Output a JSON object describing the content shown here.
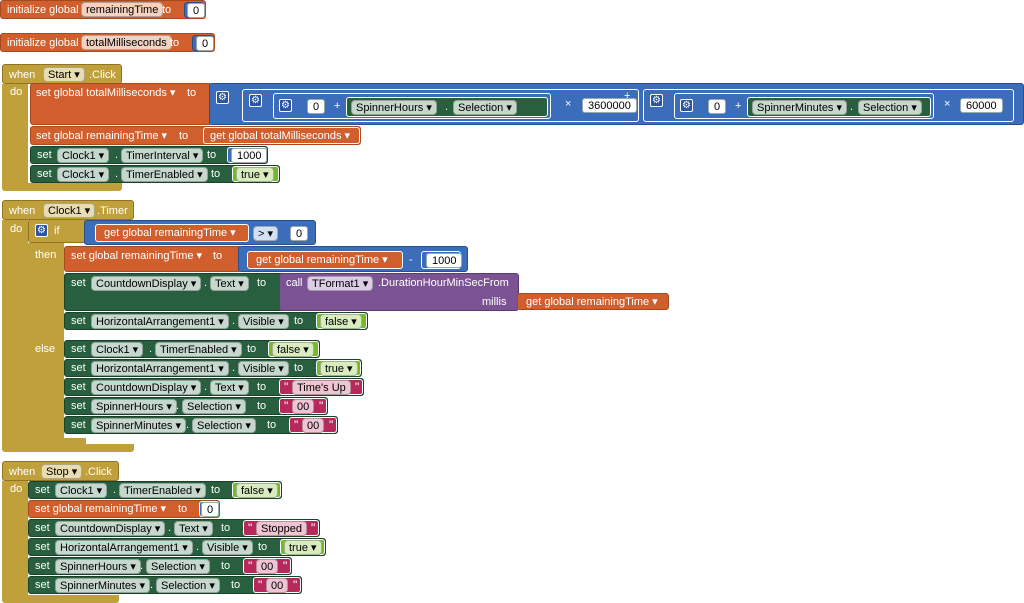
{
  "blocks": {
    "init1": {
      "keyword": "initialize global",
      "name": "remainingTime",
      "to": "to",
      "value": "0"
    },
    "init2": {
      "keyword": "initialize global",
      "name": "totalMilliseconds",
      "to": "to",
      "value": "0"
    },
    "start": {
      "when": "when",
      "component": "Start",
      "event": ".Click",
      "do": "do",
      "set_total": "set global totalMilliseconds",
      "to": "to",
      "zero1": "0",
      "plus": "+",
      "spinner_hours": "SpinnerHours",
      "selection": "Selection",
      "times": "×",
      "ms_hour": "3600000",
      "zero2": "0",
      "spinner_minutes": "SpinnerMinutes",
      "ms_minute": "60000",
      "set_remaining": "set global remainingTime",
      "get_total": "get global totalMilliseconds",
      "set": "set",
      "clock": "Clock1",
      "dot": ".",
      "timer_interval": "TimerInterval",
      "interval_value": "1000",
      "timer_enabled": "TimerEnabled",
      "true_value": "true"
    },
    "timer": {
      "when": "when",
      "component": "Clock1",
      "event": ".Timer",
      "do": "do",
      "if": "if",
      "get_remaining": "get global remainingTime",
      "gt": ">",
      "zero": "0",
      "then": "then",
      "set_remaining": "set global remainingTime",
      "to": "to",
      "minus": "-",
      "thousand": "1000",
      "set": "set",
      "countdown_display": "CountdownDisplay",
      "text_prop": "Text",
      "call": "call",
      "tformat": "TFormat1",
      "method": ".DurationHourMinSecFrom",
      "millis": "millis",
      "horizontal_arrangement": "HorizontalArrangement1",
      "visible": "Visible",
      "false_value": "false",
      "else": "else",
      "clock": "Clock1",
      "timer_enabled": "TimerEnabled",
      "true_value": "true",
      "times_up": "Time's Up",
      "spinner_hours": "SpinnerHours",
      "spinner_minutes": "SpinnerMinutes",
      "selection": "Selection",
      "zero_zero": "00",
      "dot": "."
    },
    "stop": {
      "when": "when",
      "component": "Stop",
      "event": ".Click",
      "do": "do",
      "set": "set",
      "clock": "Clock1",
      "timer_enabled": "TimerEnabled",
      "false_value": "false",
      "set_remaining": "set global remainingTime",
      "to": "to",
      "zero": "0",
      "countdown_display": "CountdownDisplay",
      "text_prop": "Text",
      "stopped": "Stopped",
      "horizontal_arrangement": "HorizontalArrangement1",
      "visible": "Visible",
      "true_value": "true",
      "spinner_hours": "SpinnerHours",
      "spinner_minutes": "SpinnerMinutes",
      "selection": "Selection",
      "zero_zero": "00",
      "dot": "."
    }
  }
}
